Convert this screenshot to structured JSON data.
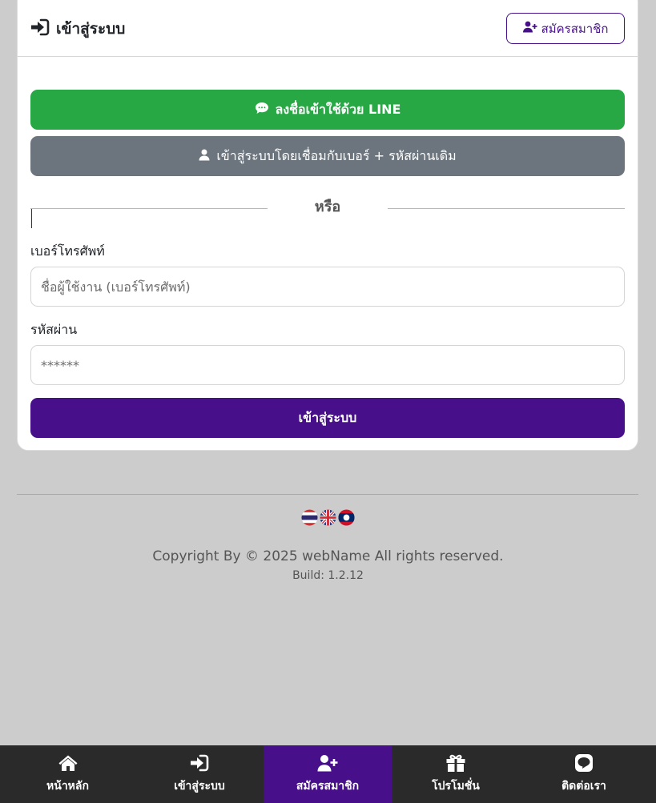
{
  "header": {
    "title": "เข้าสู่ระบบ",
    "register_label": "สมัครสมาชิก"
  },
  "social": {
    "line_label": "ลงชื่อเข้าใช้ด้วย LINE",
    "old_account_label": "เข้าสู่ระบบโดยเชื่อมกับเบอร์ + รหัสผ่านเดิม"
  },
  "divider": "หรือ",
  "form": {
    "phone_label": "เบอร์โทรศัพท์",
    "phone_placeholder": "ชื่อผู้ใช้งาน (เบอร์โทรศัพท์)",
    "password_label": "รหัสผ่าน",
    "password_placeholder": "******",
    "submit_label": "เข้าสู่ระบบ"
  },
  "footer": {
    "languages": [
      "th",
      "en",
      "lo"
    ],
    "copyright": "Copyright By © 2025 webName All rights reserved.",
    "build": "Build: 1.2.12"
  },
  "bottom_nav": [
    {
      "label": "หน้าหลัก",
      "icon": "home-icon"
    },
    {
      "label": "เข้าสู่ระบบ",
      "icon": "sign-in-icon"
    },
    {
      "label": "สมัครสมาชิก",
      "icon": "user-plus-icon",
      "active": true
    },
    {
      "label": "โปรโมชั่น",
      "icon": "gift-icon"
    },
    {
      "label": "ติดต่อเรา",
      "icon": "line-icon"
    }
  ],
  "colors": {
    "primary": "#47108a",
    "line_green": "#28a745",
    "secondary": "#6c757d",
    "nav_bg": "#2a2a2a",
    "page_bg": "#cccccc"
  }
}
